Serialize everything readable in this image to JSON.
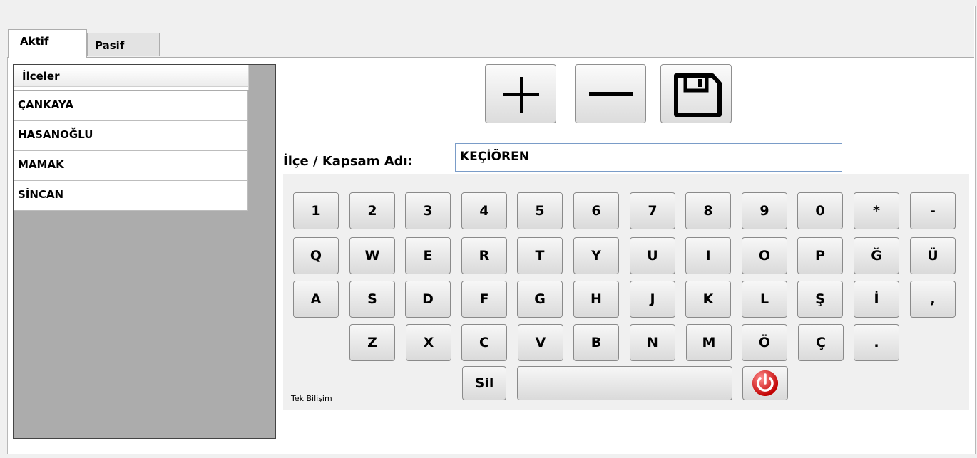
{
  "tabs": [
    {
      "label": "Aktif"
    },
    {
      "label": "Pasif"
    }
  ],
  "list": {
    "header": "İlceler",
    "items": [
      "ÇANKAYA",
      "HASANOĞLU",
      "MAMAK",
      "SİNCAN"
    ]
  },
  "toolbar": {
    "add_icon": "plus-icon",
    "remove_icon": "minus-icon",
    "save_icon": "floppy-disk-icon"
  },
  "form": {
    "label": "İlçe / Kapsam Adı:",
    "value": "KEÇİÖREN"
  },
  "keyboard": {
    "row1": [
      "1",
      "2",
      "3",
      "4",
      "5",
      "6",
      "7",
      "8",
      "9",
      "0",
      "*",
      "-"
    ],
    "row2": [
      "Q",
      "W",
      "E",
      "R",
      "T",
      "Y",
      "U",
      "I",
      "O",
      "P",
      "Ğ",
      "Ü"
    ],
    "row3": [
      "A",
      "S",
      "D",
      "F",
      "G",
      "H",
      "J",
      "K",
      "L",
      "Ş",
      "İ",
      ","
    ],
    "row4": [
      "Z",
      "X",
      "C",
      "V",
      "B",
      "N",
      "M",
      "Ö",
      "Ç",
      "."
    ],
    "backspace": "Sil",
    "space": "",
    "power_icon": "power-icon",
    "power_color": "#d40000"
  },
  "brand": "Tek Bilişim"
}
